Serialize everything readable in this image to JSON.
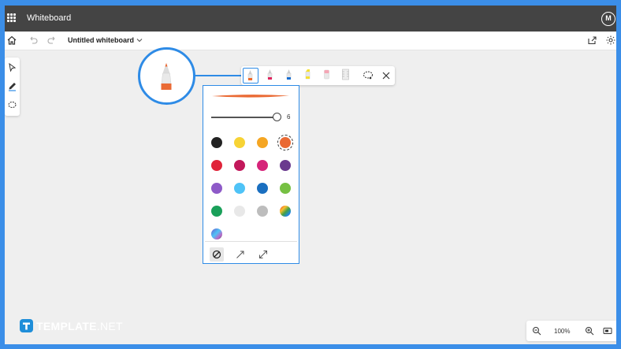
{
  "app": {
    "title": "Whiteboard",
    "user_initial": "M",
    "accent_color": "#2e8be6",
    "frame_border_color": "#3b8ee8",
    "titlebar_color": "#444444"
  },
  "command_bar": {
    "doc_title": "Untitled whiteboard",
    "icons": [
      "home-icon",
      "undo-icon",
      "redo-icon",
      "share-icon",
      "settings-icon"
    ]
  },
  "left_tools": {
    "items": [
      {
        "name": "select-tool",
        "icon": "pointer-icon"
      },
      {
        "name": "ink-tool",
        "icon": "pen-icon",
        "selected": true
      },
      {
        "name": "lasso-tool",
        "icon": "lasso-icon"
      }
    ]
  },
  "pen_toolbar": {
    "tools": [
      {
        "name": "pen",
        "color": "#f06a2a",
        "selected": true
      },
      {
        "name": "pen",
        "color": "#e0245e"
      },
      {
        "name": "pen",
        "color": "#1a6fd1"
      },
      {
        "name": "highlighter",
        "color": "#f5e033"
      },
      {
        "name": "eraser",
        "color": "#f4a6b5"
      },
      {
        "name": "ruler",
        "color": "#cccccc"
      }
    ],
    "actions": [
      "lasso-select-icon",
      "close-icon"
    ]
  },
  "palette": {
    "stroke_color": "#ea6a34",
    "thickness": "6",
    "thickness_fraction": 0.95,
    "colors": [
      "#222222",
      "#f7d335",
      "#f5a623",
      "#ea6a34",
      "#e0243a",
      "#c2185b",
      "#d6247a",
      "#6a3a8e",
      "#8e5ac8",
      "#4fc3f7",
      "#1a6fc0",
      "#76c043",
      "#1aa05a",
      "#e8e8e8",
      "#bdbdbd",
      "rainbow",
      "galaxy"
    ],
    "selected_color": "#ea6a34",
    "tip_styles": [
      "no-arrow-icon",
      "arrow-end-icon",
      "arrow-both-icon"
    ],
    "selected_tip": "no-arrow-icon"
  },
  "zoom": {
    "level": "100%"
  },
  "brand": {
    "text_bold": "TEMPLATE",
    "text_normal": ".NET"
  }
}
